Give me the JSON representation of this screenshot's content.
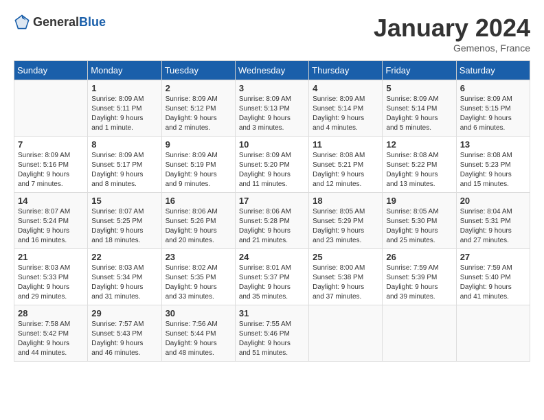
{
  "header": {
    "logo": {
      "general": "General",
      "blue": "Blue"
    },
    "month": "January 2024",
    "location": "Gemenos, France"
  },
  "weekdays": [
    "Sunday",
    "Monday",
    "Tuesday",
    "Wednesday",
    "Thursday",
    "Friday",
    "Saturday"
  ],
  "weeks": [
    [
      {
        "day": "",
        "info": ""
      },
      {
        "day": "1",
        "info": "Sunrise: 8:09 AM\nSunset: 5:11 PM\nDaylight: 9 hours\nand 1 minute."
      },
      {
        "day": "2",
        "info": "Sunrise: 8:09 AM\nSunset: 5:12 PM\nDaylight: 9 hours\nand 2 minutes."
      },
      {
        "day": "3",
        "info": "Sunrise: 8:09 AM\nSunset: 5:13 PM\nDaylight: 9 hours\nand 3 minutes."
      },
      {
        "day": "4",
        "info": "Sunrise: 8:09 AM\nSunset: 5:14 PM\nDaylight: 9 hours\nand 4 minutes."
      },
      {
        "day": "5",
        "info": "Sunrise: 8:09 AM\nSunset: 5:14 PM\nDaylight: 9 hours\nand 5 minutes."
      },
      {
        "day": "6",
        "info": "Sunrise: 8:09 AM\nSunset: 5:15 PM\nDaylight: 9 hours\nand 6 minutes."
      }
    ],
    [
      {
        "day": "7",
        "info": "Sunrise: 8:09 AM\nSunset: 5:16 PM\nDaylight: 9 hours\nand 7 minutes."
      },
      {
        "day": "8",
        "info": "Sunrise: 8:09 AM\nSunset: 5:17 PM\nDaylight: 9 hours\nand 8 minutes."
      },
      {
        "day": "9",
        "info": "Sunrise: 8:09 AM\nSunset: 5:19 PM\nDaylight: 9 hours\nand 9 minutes."
      },
      {
        "day": "10",
        "info": "Sunrise: 8:09 AM\nSunset: 5:20 PM\nDaylight: 9 hours\nand 11 minutes."
      },
      {
        "day": "11",
        "info": "Sunrise: 8:08 AM\nSunset: 5:21 PM\nDaylight: 9 hours\nand 12 minutes."
      },
      {
        "day": "12",
        "info": "Sunrise: 8:08 AM\nSunset: 5:22 PM\nDaylight: 9 hours\nand 13 minutes."
      },
      {
        "day": "13",
        "info": "Sunrise: 8:08 AM\nSunset: 5:23 PM\nDaylight: 9 hours\nand 15 minutes."
      }
    ],
    [
      {
        "day": "14",
        "info": "Sunrise: 8:07 AM\nSunset: 5:24 PM\nDaylight: 9 hours\nand 16 minutes."
      },
      {
        "day": "15",
        "info": "Sunrise: 8:07 AM\nSunset: 5:25 PM\nDaylight: 9 hours\nand 18 minutes."
      },
      {
        "day": "16",
        "info": "Sunrise: 8:06 AM\nSunset: 5:26 PM\nDaylight: 9 hours\nand 20 minutes."
      },
      {
        "day": "17",
        "info": "Sunrise: 8:06 AM\nSunset: 5:28 PM\nDaylight: 9 hours\nand 21 minutes."
      },
      {
        "day": "18",
        "info": "Sunrise: 8:05 AM\nSunset: 5:29 PM\nDaylight: 9 hours\nand 23 minutes."
      },
      {
        "day": "19",
        "info": "Sunrise: 8:05 AM\nSunset: 5:30 PM\nDaylight: 9 hours\nand 25 minutes."
      },
      {
        "day": "20",
        "info": "Sunrise: 8:04 AM\nSunset: 5:31 PM\nDaylight: 9 hours\nand 27 minutes."
      }
    ],
    [
      {
        "day": "21",
        "info": "Sunrise: 8:03 AM\nSunset: 5:33 PM\nDaylight: 9 hours\nand 29 minutes."
      },
      {
        "day": "22",
        "info": "Sunrise: 8:03 AM\nSunset: 5:34 PM\nDaylight: 9 hours\nand 31 minutes."
      },
      {
        "day": "23",
        "info": "Sunrise: 8:02 AM\nSunset: 5:35 PM\nDaylight: 9 hours\nand 33 minutes."
      },
      {
        "day": "24",
        "info": "Sunrise: 8:01 AM\nSunset: 5:37 PM\nDaylight: 9 hours\nand 35 minutes."
      },
      {
        "day": "25",
        "info": "Sunrise: 8:00 AM\nSunset: 5:38 PM\nDaylight: 9 hours\nand 37 minutes."
      },
      {
        "day": "26",
        "info": "Sunrise: 7:59 AM\nSunset: 5:39 PM\nDaylight: 9 hours\nand 39 minutes."
      },
      {
        "day": "27",
        "info": "Sunrise: 7:59 AM\nSunset: 5:40 PM\nDaylight: 9 hours\nand 41 minutes."
      }
    ],
    [
      {
        "day": "28",
        "info": "Sunrise: 7:58 AM\nSunset: 5:42 PM\nDaylight: 9 hours\nand 44 minutes."
      },
      {
        "day": "29",
        "info": "Sunrise: 7:57 AM\nSunset: 5:43 PM\nDaylight: 9 hours\nand 46 minutes."
      },
      {
        "day": "30",
        "info": "Sunrise: 7:56 AM\nSunset: 5:44 PM\nDaylight: 9 hours\nand 48 minutes."
      },
      {
        "day": "31",
        "info": "Sunrise: 7:55 AM\nSunset: 5:46 PM\nDaylight: 9 hours\nand 51 minutes."
      },
      {
        "day": "",
        "info": ""
      },
      {
        "day": "",
        "info": ""
      },
      {
        "day": "",
        "info": ""
      }
    ]
  ]
}
